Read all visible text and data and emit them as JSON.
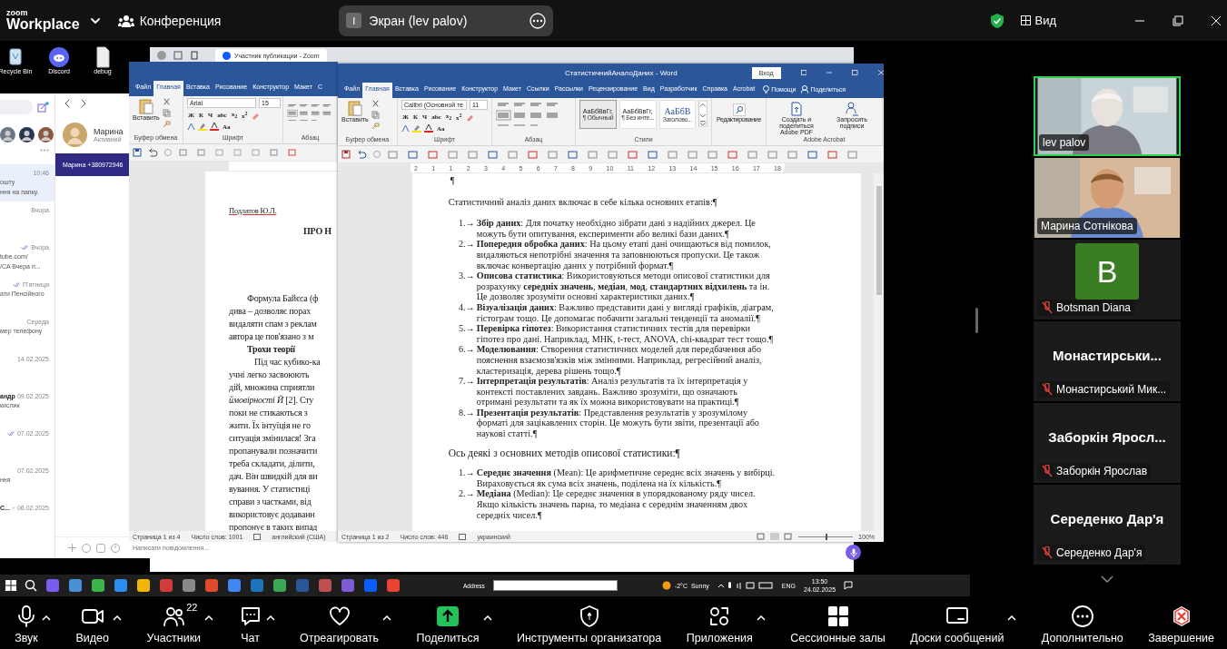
{
  "topbar": {
    "brand": "zoom",
    "app": "Workplace",
    "meeting": "Конференция",
    "share_pill": {
      "avatar": "I",
      "label": "Экран (lev palov)"
    },
    "view": "Вид"
  },
  "desktop": {
    "icons": [
      {
        "label": "Recycle Bin"
      },
      {
        "label": "Discord"
      },
      {
        "label": "debug"
      }
    ]
  },
  "browser": {
    "tab": "Участник публикации - Zoom"
  },
  "messenger": {
    "contact": {
      "name": "Марина",
      "status": "Активний"
    },
    "banner": "Марина +380972946",
    "placeholder": "Написати повідомлення...",
    "chats": [
      {
        "time": "10:46",
        "lines": [
          "ошту",
          "ння на папку."
        ],
        "selected": true,
        "read": false
      },
      {
        "time": "Вчора",
        "selected": false,
        "read": false
      },
      {
        "time": "Вчора",
        "lines": [
          "tube.com/",
          "/CA  Вчера п..."
        ],
        "selected": false,
        "read": true
      },
      {
        "time": "П'ятниця",
        "lines": [
          "ати Пенсійного"
        ],
        "selected": false,
        "read": true
      },
      {
        "time": "Середа",
        "lines": [
          "мер телефону"
        ],
        "selected": false,
        "read": false
      },
      {
        "time": "14.02.2025",
        "selected": false,
        "read": false
      },
      {
        "title": "андр",
        "time": "09.02.2025",
        "lines": [
          "кислик"
        ],
        "selected": false,
        "read": false
      },
      {
        "time": "07.02.2025",
        "selected": false,
        "read": true
      },
      {
        "time": "07.02.2025",
        "lines": [
          "ння"
        ],
        "selected": false,
        "read": false
      },
      {
        "title": "С...",
        "time": "06.02.2025",
        "selected": false,
        "read": true
      }
    ]
  },
  "back_word": {
    "tabs": [
      {
        "label": "Файл",
        "selected": false
      },
      {
        "label": "Главная",
        "selected": true
      },
      {
        "label": "Вставка",
        "selected": false
      },
      {
        "label": "Рисование",
        "selected": false
      },
      {
        "label": "Конструктор",
        "selected": false
      },
      {
        "label": "Макет",
        "selected": false
      },
      {
        "label": "С",
        "selected": false
      }
    ],
    "ribbon": {
      "paste": "Вставить",
      "clipboard": "Буфер обмена",
      "font": "Arial",
      "size": "15",
      "format_buttons": [
        "Ж",
        "К",
        "Ч",
        "abc",
        "x$_{2}$",
        "x$^{2}$"
      ],
      "case": "Aa",
      "font_label": "Шрифт",
      "paragraph_label": "Абзац"
    },
    "lines": [
      {
        "kind": "author",
        "text": "Подлатов Ю.Л."
      },
      {
        "kind": "title",
        "text": "ПРО Н"
      },
      {
        "kind": "first",
        "text": "Формула Байєса (ф"
      },
      {
        "kind": "line",
        "text": "дива – дозволяє порах"
      },
      {
        "kind": "line",
        "text": "видаляти спам з реклам"
      },
      {
        "kind": "line",
        "text": "автора це пов'язано з м"
      },
      {
        "kind": "heading",
        "text": "Трохи теорії"
      },
      {
        "kind": "para",
        "text": "Під час кубико-ка"
      },
      {
        "kind": "line",
        "text": "учні легко засвоюють"
      },
      {
        "kind": "line",
        "text": "дій, множина сприятли"
      },
      {
        "kind": "line",
        "text": "*ймовірності Й* [2]. Сту"
      },
      {
        "kind": "line",
        "text": "поки  не стикаються з"
      },
      {
        "kind": "line",
        "text": "жити. Їх інтуїція не го"
      },
      {
        "kind": "line",
        "text": "ситуація змінилася! Зга"
      },
      {
        "kind": "line",
        "text": "пропанували позначити"
      },
      {
        "kind": "line",
        "text": "треба складати, ділити,"
      },
      {
        "kind": "line",
        "text": "дач. Він швидкій для ви"
      },
      {
        "kind": "line",
        "text": "вування.  У  статистиці"
      },
      {
        "kind": "line",
        "text": "справи з частками, від"
      },
      {
        "kind": "line",
        "text": "використовує додаванн"
      },
      {
        "kind": "line",
        "text": "пропонує в таких випад"
      }
    ],
    "status": {
      "page": "Страница 1 из 4",
      "words": "Число слов: 1001",
      "language": "английский (США)"
    }
  },
  "word": {
    "title": "СтатистичнийАналоДаних - Word",
    "signin": "Вход",
    "tabs": [
      {
        "label": "Файл",
        "selected": false
      },
      {
        "label": "Главная",
        "selected": true
      },
      {
        "label": "Вставка",
        "selected": false
      },
      {
        "label": "Рисование",
        "selected": false
      },
      {
        "label": "Конструктор",
        "selected": false
      },
      {
        "label": "Макет",
        "selected": false
      },
      {
        "label": "Ссылки",
        "selected": false
      },
      {
        "label": "Рассылки",
        "selected": false
      },
      {
        "label": "Рецензирование",
        "selected": false
      },
      {
        "label": "Вид",
        "selected": false
      },
      {
        "label": "Разработчик",
        "selected": false
      },
      {
        "label": "Справка",
        "selected": false
      },
      {
        "label": "Acrobat",
        "selected": false
      }
    ],
    "help": "Помощи",
    "share": "Поделиться",
    "ribbon": {
      "paste": "Вставить",
      "clipboard": "Буфер обмена",
      "font": "Calibri (Основной те",
      "size": "11",
      "format_buttons": [
        "Ж",
        "К",
        "Ч",
        "abc",
        "x$_{2}$",
        "x$^{2}$"
      ],
      "case": "Aa",
      "font_label": "Шрифт",
      "paragraph_label": "Абзац",
      "styles": [
        {
          "sample": "АаБбВвГг,",
          "name": "¶ Обычный",
          "selected": true
        },
        {
          "sample": "АаБбВвГг,",
          "name": "¶ Без инте...",
          "selected": false
        },
        {
          "sample": "АаБбВ",
          "name": "Заголово...",
          "selected": false
        }
      ],
      "styles_label": "Стили",
      "editing": "Редактирование",
      "acrobat_buttons": [
        "Создать и поделиться Adobe PDF",
        "Запросить подписи"
      ],
      "acrobat_label": "Adobe Acrobat"
    },
    "ruler": [
      "2",
      "1",
      "1",
      "2",
      "3",
      "4",
      "5",
      "6",
      "7",
      "8",
      "9",
      "10",
      "11",
      "12",
      "13",
      "14",
      "15",
      "16",
      "17",
      "18"
    ],
    "document": [
      {
        "kind": "mark",
        "text": "¶"
      },
      {
        "kind": "para",
        "text": "Статистичний аналіз даних включає в себе кілька основних етапів:¶"
      },
      {
        "kind": "list",
        "items": [
          {
            "number": "1.→",
            "text": "**Збір даних**: Для початку необхідно зібрати дані з надійних джерел. Це можуть бути опитування, експерименти або великі бази даних.¶"
          },
          {
            "number": "2.→",
            "text": "**Попередня обробка даних**: На цьому етапі дані очищаються від помилок, видаляються непотрібні значення та заповнюються пропуски. Це також включає конвертацію даних у потрібний формат.¶"
          },
          {
            "number": "3.→",
            "text": "**Описова статистика**: Використовуються методи описової статистики для розрахунку **середніх значень**, **медіан**, **мод**, **стандартних відхилень** та ін. Це дозволяє зрозуміти основні характеристики даних.¶"
          },
          {
            "number": "4.→",
            "text": "**Візуалізація даних**: Важливо представити дані у вигляді графіків, діаграм, гістограм тощо. Це допомагає побачити загальні тенденції та аномалії.¶"
          },
          {
            "number": "5.→",
            "text": "**Перевірка гіпотез**: Використання статистичних тестів для перевірки гіпотез про дані. Наприклад, МНК, t-тест, ANOVA, chi-квадрат тест тощо.¶"
          },
          {
            "number": "6.→",
            "text": "**Моделювання**: Створення статистичних моделей для передбачення або пояснення взаємозв'язків між змінними. Наприклад, регресійний аналіз, кластеризація, дерева рішень тощо.¶"
          },
          {
            "number": "7.→",
            "text": "**Інтерпретація результатів**: Аналіз результатів та їх інтерпретація у контексті поставлених завдань. Важливо зрозуміти, що означають отримані результати та як їх можна використовувати на практиці.¶"
          },
          {
            "number": "8.→",
            "text": "**Презентація результатів**: Представлення результатів у зрозумілому форматі для зацікавлених сторін. Це можуть бути звіти, презентації або наукові статті.¶"
          }
        ]
      },
      {
        "kind": "heading",
        "text": "Ось деякі з основних методів описової статистики:¶"
      },
      {
        "kind": "list",
        "items": [
          {
            "number": "1.→",
            "text": "**Середнє значення** (Mean): Це арифметичне середнє всіх значень у вибірці. Вираховується як сума всіх значень, поділена на їх кількість.¶"
          },
          {
            "number": "2.→",
            "text": "**Медіана** (Median): Це середнє значення в упорядкованому ряду чисел. Якщо кількість значень парна, то медіана є середнім значенням двох середніх чисел.¶"
          }
        ]
      }
    ],
    "status": {
      "page": "Страница 1 из 2",
      "words": "Число слов: 446",
      "language": "украинский",
      "zoom": {
        "level": 0.5,
        "reading": "100%"
      }
    }
  },
  "taskbar": {
    "address": "Address",
    "temperature": "-2°C",
    "weather": "Sunny",
    "language": "ENG",
    "time": "13:50",
    "date": "24.02.2025"
  },
  "participants": [
    {
      "kind": "video",
      "name": "lev palov",
      "speaking": true,
      "muted": false
    },
    {
      "kind": "video",
      "name": "Марина Сотнікова",
      "speaking": false,
      "muted": false
    },
    {
      "kind": "avatar",
      "initial": "B",
      "name": "Botsman Diana",
      "speaking": false,
      "muted": true
    },
    {
      "kind": "name",
      "title": "Монастирськи...",
      "name": "Монастирський Мик...",
      "speaking": false,
      "muted": true
    },
    {
      "kind": "name",
      "title": "Заборкін Яросл...",
      "name": "Заборкін Ярослав",
      "speaking": false,
      "muted": true
    },
    {
      "kind": "name",
      "title": "Середенко Дар'я",
      "name": "Середенко Дар'я",
      "speaking": false,
      "muted": true
    }
  ],
  "toolbar": [
    {
      "label": "Звук",
      "caret": true
    },
    {
      "label": "Видео",
      "caret": true
    },
    {
      "label": "Участники",
      "count": "22",
      "caret": true
    },
    {
      "label": "Чат",
      "caret": true
    },
    {
      "label": "Отреагировать",
      "caret": true
    },
    {
      "label": "Поделиться",
      "caret": true
    },
    {
      "label": "Инструменты организатора",
      "caret": false
    },
    {
      "label": "Приложения",
      "caret": true
    },
    {
      "label": "Сессионные залы",
      "caret": false
    },
    {
      "label": "Доски сообщений",
      "caret": true
    },
    {
      "label": "Дополнительно",
      "caret": false
    },
    {
      "label": "Завершение",
      "caret": false
    }
  ]
}
